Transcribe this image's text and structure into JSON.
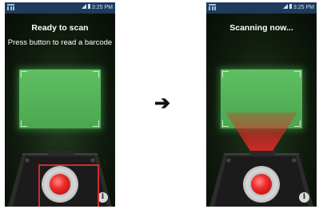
{
  "left_screen": {
    "status_time": "3:25 PM",
    "title": "Ready to scan",
    "subtitle": "Press button to read a barcode"
  },
  "right_screen": {
    "status_time": "3:25 PM",
    "title": "Scanning now..."
  },
  "transition_arrow": "➔",
  "info_glyph": "i",
  "colors": {
    "scan_window": "#4aa84f",
    "scan_button": "#ee2a2a",
    "highlight_box": "#d42a2a",
    "status_bar": "#1f3a5c"
  }
}
